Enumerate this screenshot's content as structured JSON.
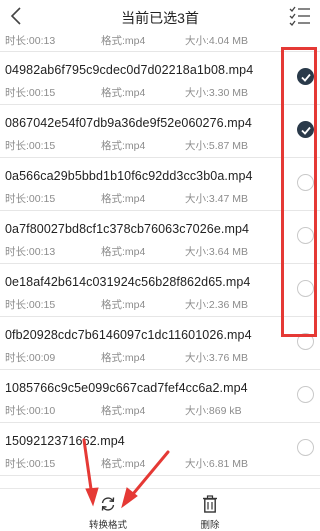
{
  "header": {
    "title": "当前已选3首",
    "back_icon": "chevron-left-icon",
    "select_icon": "checklist-icon"
  },
  "labels": {
    "duration": "时长:",
    "format": "格式:",
    "size": "大小:"
  },
  "partial_top": {
    "duration": "00:13",
    "format": "mp4",
    "size": "4.04 MB"
  },
  "files": [
    {
      "name": "04982ab6f795c9cdec0d7d02218a1b08.mp4",
      "duration": "00:15",
      "format": "mp4",
      "size": "3.30 MB",
      "checked": true
    },
    {
      "name": "0867042e54f07db9a36de9f52e060276.mp4",
      "duration": "00:15",
      "format": "mp4",
      "size": "5.87 MB",
      "checked": true
    },
    {
      "name": "0a566ca29b5bbd1b10f6c92dd3cc3b0a.mp4",
      "duration": "00:15",
      "format": "mp4",
      "size": "3.47 MB",
      "checked": false
    },
    {
      "name": "0a7f80027bd8cf1c378cb76063c7026e.mp4",
      "duration": "00:13",
      "format": "mp4",
      "size": "3.64 MB",
      "checked": false
    },
    {
      "name": "0e18af42b614c031924c56b28f862d65.mp4",
      "duration": "00:15",
      "format": "mp4",
      "size": "2.36 MB",
      "checked": false
    },
    {
      "name": "0fb20928cdc7b6146097c1dc11601026.mp4",
      "duration": "00:09",
      "format": "mp4",
      "size": "3.76 MB",
      "checked": false
    },
    {
      "name": "1085766c9c5e099c667cad7fef4cc6a2.mp4",
      "duration": "00:10",
      "format": "mp4",
      "size": "869 kB",
      "checked": false
    },
    {
      "name": "1509212371662.mp4",
      "duration": "00:15",
      "format": "mp4",
      "size": "6.81 MB",
      "checked": false
    }
  ],
  "toolbar": {
    "convert_label": "转换格式",
    "delete_label": "删除",
    "convert_icon": "refresh-icon",
    "delete_icon": "trash-icon"
  },
  "colors": {
    "check_fill": "#2a3a4a",
    "annotation": "#e53935"
  }
}
